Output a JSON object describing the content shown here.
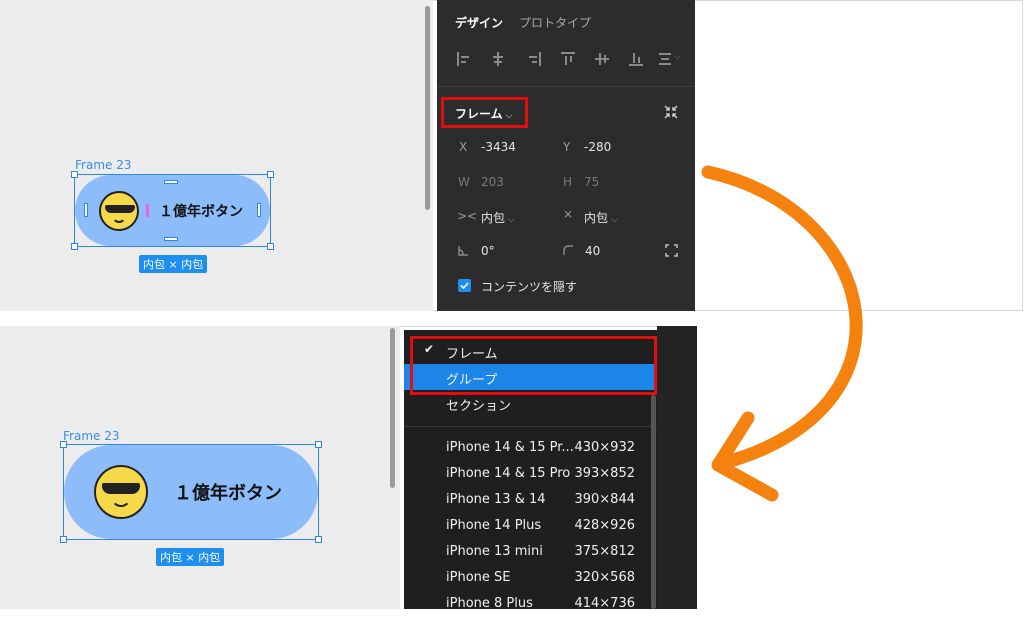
{
  "top_canvas": {
    "frame_label": "Frame 23",
    "button_label": "１億年ボタン",
    "size_badge": "内包 × 内包"
  },
  "panel": {
    "tabs": [
      "デザイン",
      "プロトタイプ"
    ],
    "frame_dropdown": "フレーム",
    "x_label": "X",
    "x_value": "-3434",
    "y_label": "Y",
    "y_value": "-280",
    "w_label": "W",
    "w_value": "203",
    "h_label": "H",
    "h_value": "75",
    "h_resizing": "内包",
    "v_resizing": "内包",
    "rotation": "0°",
    "radius": "40",
    "clip_content": "コンテンツを隠す",
    "clip_checked": true
  },
  "bottom_canvas": {
    "frame_label": "Frame 23",
    "button_label": "１億年ボタン",
    "size_badge": "内包 × 内包"
  },
  "menu": {
    "types": [
      {
        "label": "フレーム",
        "checked": true
      },
      {
        "label": "グループ",
        "highlighted": true
      },
      {
        "label": "セクション"
      }
    ],
    "presets": [
      {
        "name": "iPhone 14 & 15 Pr...",
        "size": "430×932"
      },
      {
        "name": "iPhone 14 & 15 Pro",
        "size": "393×852"
      },
      {
        "name": "iPhone 13 & 14",
        "size": "390×844"
      },
      {
        "name": "iPhone 14 Plus",
        "size": "428×926"
      },
      {
        "name": "iPhone 13 mini",
        "size": "375×812"
      },
      {
        "name": "iPhone SE",
        "size": "320×568"
      },
      {
        "name": "iPhone 8 Plus",
        "size": "414×736"
      }
    ]
  },
  "colors": {
    "accent_blue": "#1e8ef0",
    "pill": "#8cbdfa",
    "highlight_red": "#e01010",
    "arrow_orange": "#f5820f",
    "panel_bg": "#2c2c2c"
  }
}
